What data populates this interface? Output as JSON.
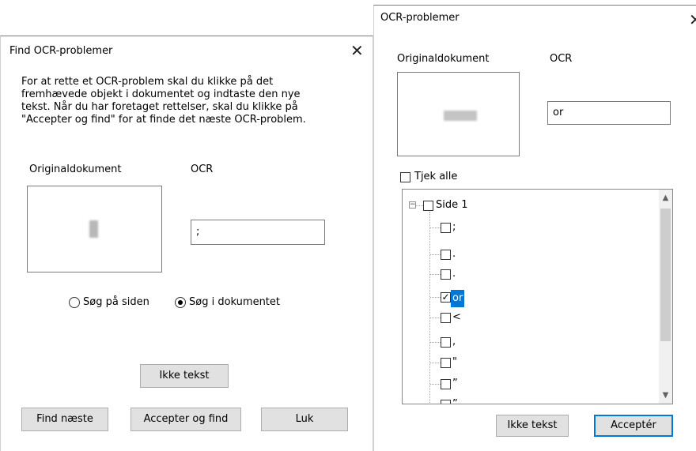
{
  "dialog1": {
    "title": "Find OCR-problemer",
    "instructions": [
      "For at rette et OCR-problem skal du klikke på det",
      "fremhævede objekt i dokumentet og indtaste den nye",
      "tekst. Når du har foretaget rettelser, skal du klikke på",
      "\"Accepter og find\" for at finde det næste OCR-problem."
    ],
    "original_label": "Originaldokument",
    "ocr_label": "OCR",
    "ocr_value": ";",
    "radio_page": "Søg på siden",
    "radio_document": "Søg i dokumentet",
    "selected_scope": "Søg i dokumentet",
    "not_text_button": "Ikke tekst",
    "find_next_button": "Find næste",
    "accept_find_button": "Accepter og find",
    "close_button": "Luk"
  },
  "dialog2": {
    "title": "OCR-problemer",
    "original_label": "Originaldokument",
    "ocr_label": "OCR",
    "ocr_value": "or",
    "check_all_label": "Tjek alle",
    "tree": {
      "root": "Side 1",
      "items": [
        {
          "label": ";",
          "checked": false,
          "selected": false
        },
        {
          "label": ".",
          "checked": false,
          "selected": false
        },
        {
          "label": ".",
          "checked": false,
          "selected": false
        },
        {
          "label": "or",
          "checked": true,
          "selected": true
        },
        {
          "label": "<",
          "checked": false,
          "selected": false
        },
        {
          "label": ",",
          "checked": false,
          "selected": false
        },
        {
          "label": "\"",
          "checked": false,
          "selected": false
        },
        {
          "label": "”",
          "checked": false,
          "selected": false
        },
        {
          "label": "”",
          "checked": false,
          "selected": false
        }
      ]
    },
    "not_text_button": "Ikke tekst",
    "accept_button": "Acceptér"
  },
  "colors": {
    "selection": "#0078d7",
    "default_button_border": "#0078d7"
  }
}
